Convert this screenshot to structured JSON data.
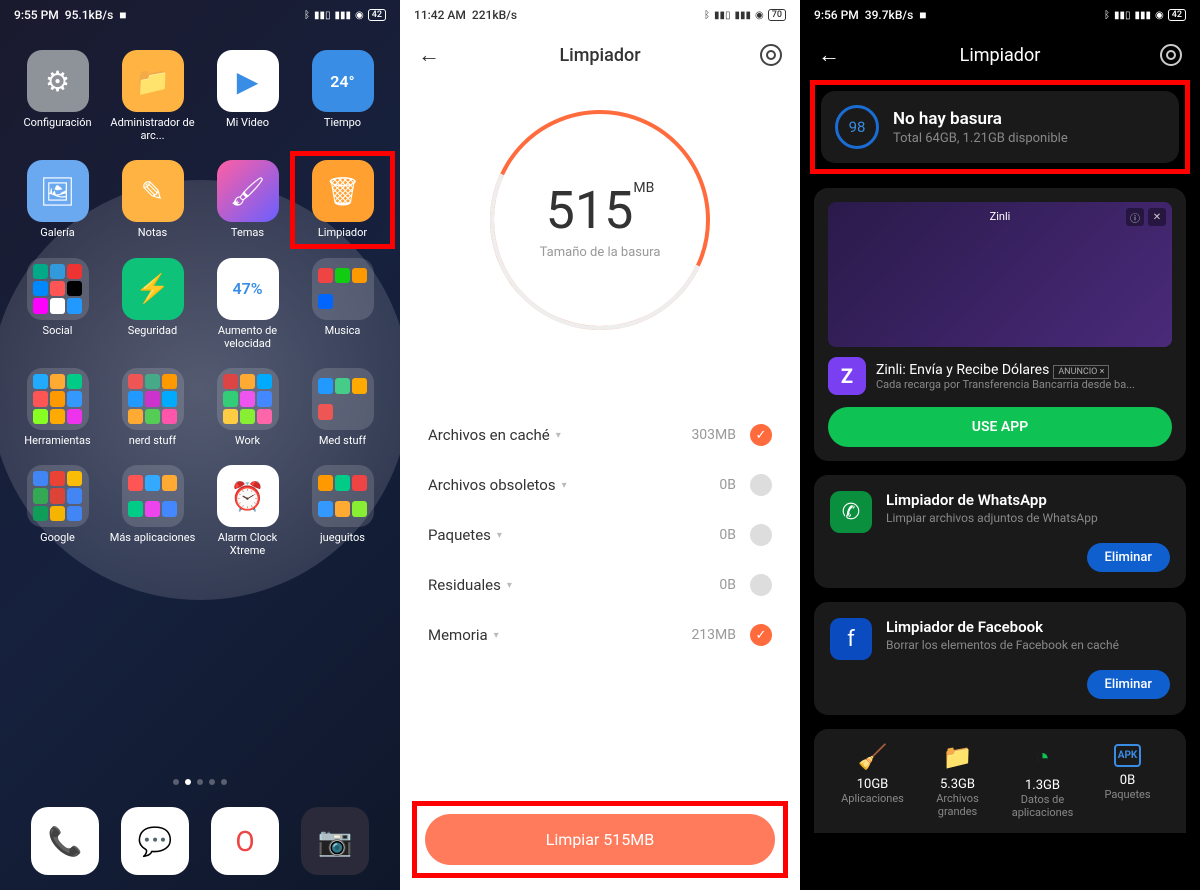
{
  "screen1": {
    "status": {
      "time": "9:55 PM",
      "net": "95.1kB/s",
      "battery": "42"
    },
    "apps": [
      {
        "label": "Configuración",
        "bg": "#8e9299",
        "glyph": "⚙"
      },
      {
        "label": "Administrador de arc...",
        "bg": "#ffb342",
        "glyph": "📁"
      },
      {
        "label": "Mi Video",
        "bg": "#ffffff",
        "glyph": "▶"
      },
      {
        "label": "Tiempo",
        "bg": "#3a8de4",
        "glyph": "24°"
      },
      {
        "label": "Galería",
        "bg": "#6aa8f0",
        "glyph": "🖼"
      },
      {
        "label": "Notas",
        "bg": "#ffb342",
        "glyph": "✎"
      },
      {
        "label": "Temas",
        "bg": "linear-gradient(135deg,#ff5fa2,#6a5fff)",
        "glyph": "🖌"
      },
      {
        "label": "Limpiador",
        "bg": "#ffa030",
        "glyph": "🗑",
        "highlight": true
      },
      {
        "label": "Social",
        "folder": true,
        "colors": [
          "#0a8",
          "#39d",
          "#e33",
          "#08f",
          "#f55",
          "#000",
          "#f0f",
          "#fff",
          "#29f"
        ]
      },
      {
        "label": "Seguridad",
        "bg": "#0ec27a",
        "glyph": "⚡"
      },
      {
        "label": "Aumento de velocidad",
        "bg": "#ffffff",
        "glyph": "47%"
      },
      {
        "label": "Musica",
        "folder": true,
        "colors": [
          "#e44",
          "#1c1",
          "#f90",
          "#06f"
        ]
      },
      {
        "label": "Herramientas",
        "folder": true,
        "colors": [
          "#2af",
          "#fa3",
          "#0c8",
          "#f55",
          "#f90",
          "#39f",
          "#8f2",
          "#fa0",
          "#e3e"
        ]
      },
      {
        "label": "nerd stuff",
        "folder": true,
        "colors": [
          "#e55",
          "#4a8",
          "#f90",
          "#29f",
          "#c3c",
          "#0af",
          "#fa3",
          "#5c5",
          "#f5a"
        ]
      },
      {
        "label": "Work",
        "folder": true,
        "colors": [
          "#d44",
          "#fa3",
          "#0af",
          "#3c7",
          "#e5e",
          "#48f",
          "#fc4",
          "#8e3",
          "#f6a"
        ]
      },
      {
        "label": "Med stuff",
        "folder": true,
        "colors": [
          "#29f",
          "#4c8",
          "#fa0",
          "#e55"
        ]
      },
      {
        "label": "Google",
        "folder": true,
        "colors": [
          "#4285f4",
          "#ea4335",
          "#fbbc05",
          "#34a853",
          "#db4437",
          "#4285f4",
          "#0f9d58",
          "#f4b400",
          "#4285f4"
        ]
      },
      {
        "label": "Más aplicaciones",
        "folder": true,
        "colors": [
          "#f55",
          "#3af",
          "#fa3",
          "#0c8",
          "#e4e",
          "#48f"
        ]
      },
      {
        "label": "Alarm Clock Xtreme",
        "bg": "#ffffff",
        "glyph": "⏰"
      },
      {
        "label": "jueguitos",
        "folder": true,
        "colors": [
          "#f90",
          "#0c8",
          "#e44",
          "#39f",
          "#fa3",
          "#8e3"
        ]
      }
    ],
    "dock": [
      {
        "bg": "#ffffff",
        "glyph": "📞",
        "name": "phone"
      },
      {
        "bg": "#ffffff",
        "glyph": "💬",
        "name": "messages"
      },
      {
        "bg": "#ffffff",
        "glyph": "O",
        "name": "opera",
        "color": "#e44"
      },
      {
        "bg": "#2a2a3a",
        "glyph": "📷",
        "name": "camera"
      }
    ]
  },
  "screen2": {
    "status": {
      "time": "11:42 AM",
      "net": "221kB/s",
      "battery": "70"
    },
    "title": "Limpiador",
    "trash_size": "515",
    "trash_unit": "MB",
    "trash_label": "Tamaño de la basura",
    "categories": [
      {
        "name": "Archivos en caché",
        "size": "303MB",
        "checked": true
      },
      {
        "name": "Archivos obsoletos",
        "size": "0B",
        "checked": false
      },
      {
        "name": "Paquetes",
        "size": "0B",
        "checked": false
      },
      {
        "name": "Residuales",
        "size": "0B",
        "checked": false
      },
      {
        "name": "Memoria",
        "size": "213MB",
        "checked": true
      }
    ],
    "clean_button": "Limpiar 515MB"
  },
  "screen3": {
    "status": {
      "time": "9:56 PM",
      "net": "39.7kB/s",
      "battery": "42"
    },
    "title": "Limpiador",
    "score": "98",
    "result_title": "No hay basura",
    "result_sub": "Total 64GB, 1.21GB disponible",
    "ad": {
      "brand": "Zinli",
      "title": "Zinli: Envía y Recibe Dólares",
      "badge": "ANUNCIO ×",
      "sub": "Cada recarga por Transferencia Bancarria desde ba...",
      "cta": "USE APP"
    },
    "tools": [
      {
        "title": "Limpiador de WhatsApp",
        "sub": "Limpiar archivos adjuntos de WhatsApp",
        "btn": "Eliminar",
        "icon": "wa",
        "glyph": "✆"
      },
      {
        "title": "Limpiador de Facebook",
        "sub": "Borrar los elementos de Facebook en caché",
        "btn": "Eliminar",
        "icon": "fb",
        "glyph": "f"
      }
    ],
    "bottom": [
      {
        "icon": "🧹",
        "color": "#ff8a3d",
        "size": "10GB",
        "label": "Aplicaciones"
      },
      {
        "icon": "📁",
        "color": "#ffcc33",
        "size": "5.3GB",
        "label": "Archivos grandes"
      },
      {
        "icon": "◔",
        "color": "#0ec254",
        "size": "1.3GB",
        "label": "Datos de aplicaciones"
      },
      {
        "icon": "APK",
        "color": "#3a8de4",
        "size": "0B",
        "label": "Paquetes"
      }
    ]
  }
}
